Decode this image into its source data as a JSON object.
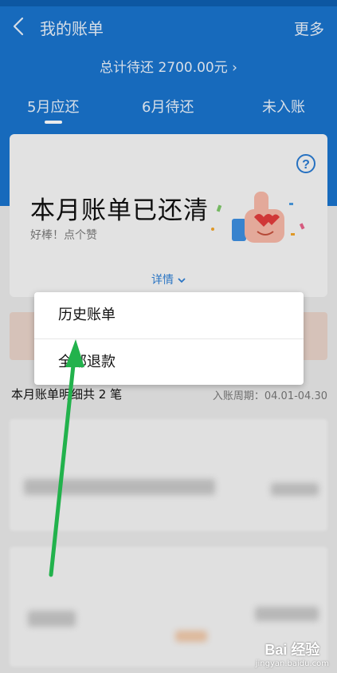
{
  "header": {
    "title": "我的账单",
    "more": "更多",
    "total": "总计待还 2700.00元 ›"
  },
  "tabs": [
    {
      "label": "5月应还"
    },
    {
      "label": "6月待还"
    },
    {
      "label": "未入账"
    }
  ],
  "card": {
    "title": "本月账单已还清",
    "subtitle": "好棒！点个赞",
    "details": "详情",
    "help": "?"
  },
  "bill_summary": {
    "count_text": "本月账单明细共 2 笔",
    "period": "入账周期：04.01-04.30"
  },
  "popup": {
    "items": [
      {
        "label": "历史账单"
      },
      {
        "label": "全部退款"
      }
    ]
  },
  "watermark": {
    "brand": "Bai 经验",
    "url": "jingyan.baidu.com"
  },
  "colors": {
    "header_blue": "#1a73cc",
    "arrow_green": "#22b24c",
    "link_blue": "#2f7fd4"
  }
}
